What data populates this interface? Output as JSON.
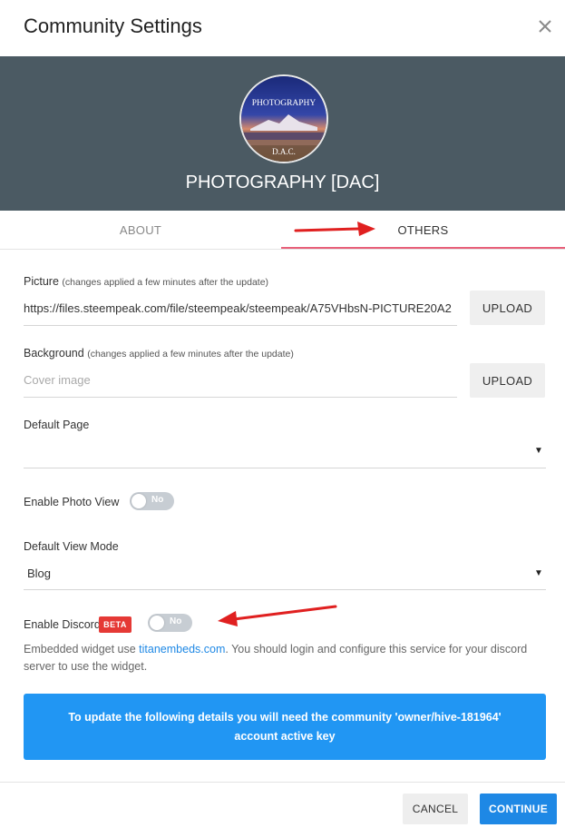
{
  "dialog": {
    "title": "Community Settings",
    "close_icon": "close-icon"
  },
  "banner": {
    "avatar_text_top": "PHOTOGRAPHY",
    "avatar_text_bottom": "D.A.C.",
    "community_name": "PHOTOGRAPHY [DAC]",
    "background_color": "#4b5a63"
  },
  "tabs": [
    {
      "label": "ABOUT",
      "active": false
    },
    {
      "label": "OTHERS",
      "active": true
    }
  ],
  "tab_accent_color": "#e8607a",
  "fields": {
    "picture": {
      "label": "Picture",
      "note": "(changes applied a few minutes after the update)",
      "value": "https://files.steempeak.com/file/steempeak/steempeak/A75VHbsN-PICTURE20A2",
      "button": "UPLOAD"
    },
    "background": {
      "label": "Background",
      "note": "(changes applied a few minutes after the update)",
      "placeholder": "Cover image",
      "button": "UPLOAD"
    },
    "default_page": {
      "label": "Default Page",
      "value": ""
    },
    "enable_photo_view": {
      "label": "Enable Photo View",
      "state": "No"
    },
    "default_view_mode": {
      "label": "Default View Mode",
      "value": "Blog"
    },
    "enable_discord": {
      "label": "Enable Discord",
      "badge": "BETA",
      "state": "No"
    }
  },
  "discord_help": {
    "before_link": "Embedded widget use ",
    "link": "titanembeds.com",
    "after_link": ". You should login and configure this service for your discord server to use the widget."
  },
  "info_box": {
    "text": "To update the following details you will need the community 'owner/hive-181964' account active key",
    "color": "#2196f3"
  },
  "footer": {
    "cancel_label": "CANCEL",
    "continue_label": "CONTINUE",
    "continue_color": "#1e88e5"
  },
  "annotation_color": "#e02020"
}
